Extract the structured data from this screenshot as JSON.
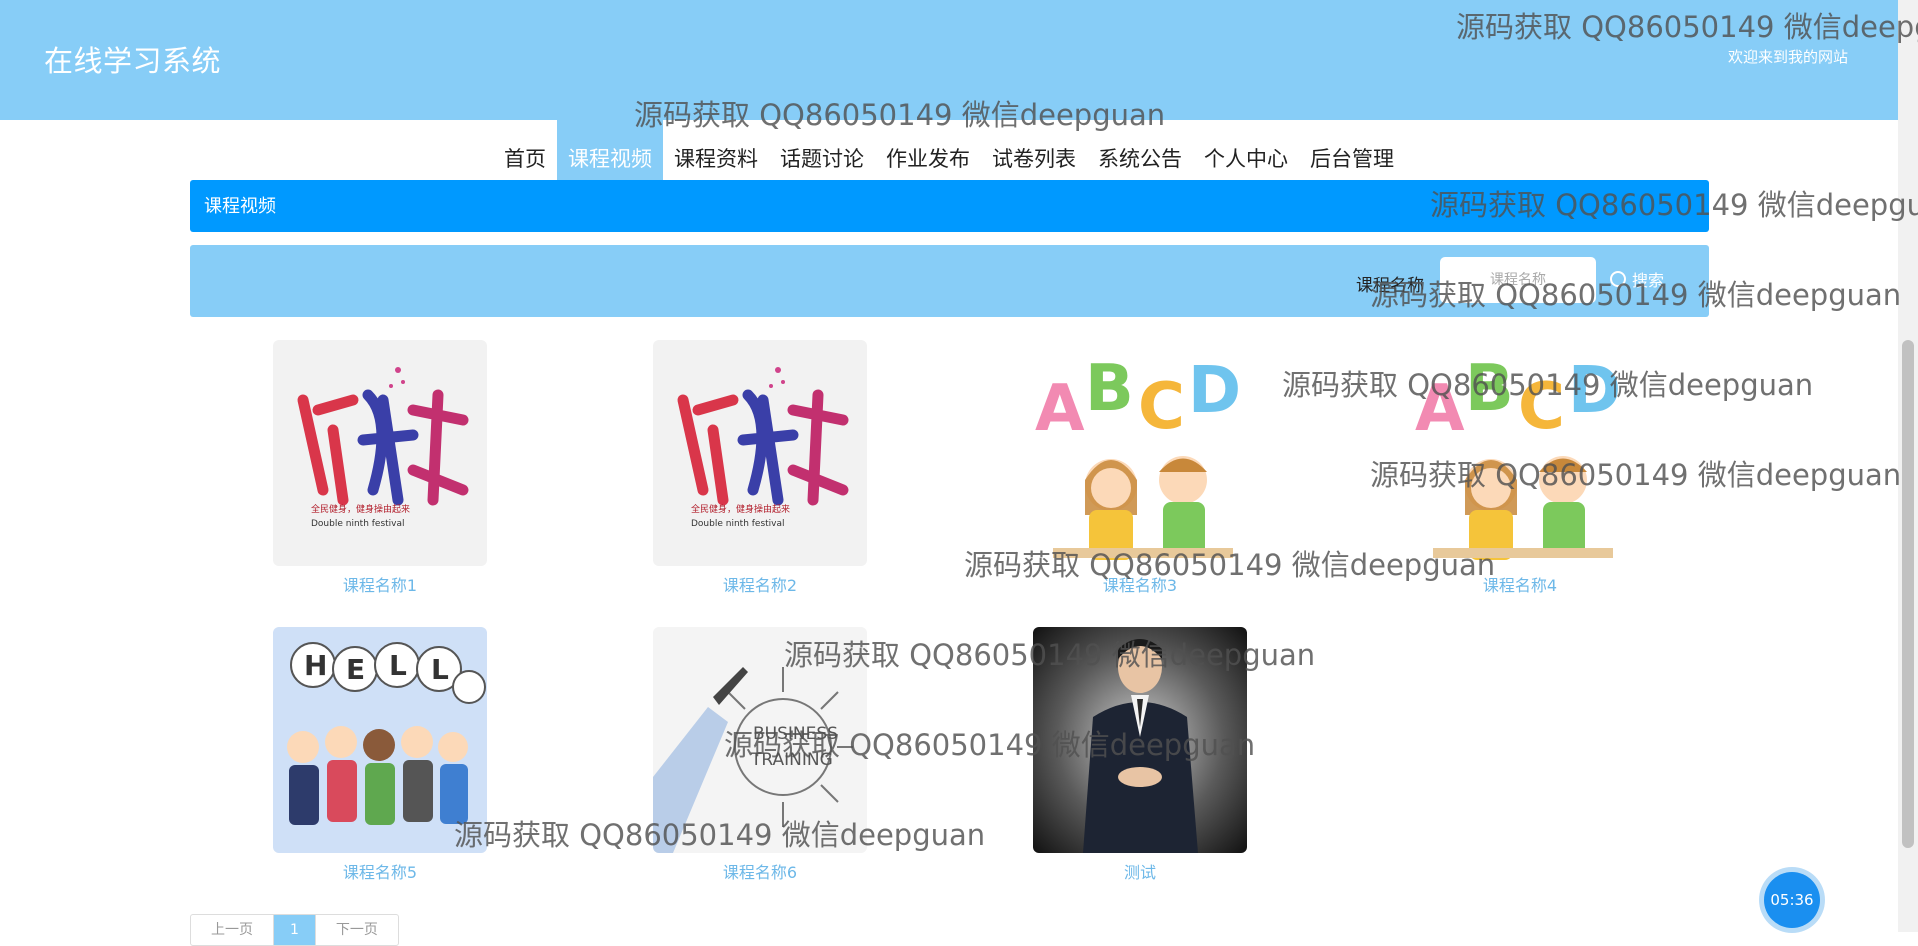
{
  "header": {
    "site_title": "在线学习系统",
    "welcome": "欢迎来到我的网站"
  },
  "nav": {
    "items": [
      "首页",
      "课程视频",
      "课程资料",
      "话题讨论",
      "作业发布",
      "试卷列表",
      "系统公告",
      "个人中心",
      "后台管理"
    ],
    "active": "课程视频"
  },
  "section": {
    "title": "课程视频"
  },
  "search": {
    "label": "课程名称",
    "placeholder": "课程名称",
    "button": "搜索"
  },
  "courses": [
    {
      "title": "课程名称1",
      "image": "fitness-calligraphy-poster"
    },
    {
      "title": "课程名称2",
      "image": "fitness-calligraphy-poster"
    },
    {
      "title": "课程名称3",
      "image": "abcd-kids-cartoon"
    },
    {
      "title": "课程名称4",
      "image": "abcd-kids-cartoon"
    },
    {
      "title": "课程名称5",
      "image": "hello-people-cartoon"
    },
    {
      "title": "课程名称6",
      "image": "business-training-sketch"
    },
    {
      "title": "测试",
      "image": "man-in-suit-photo"
    }
  ],
  "pager": {
    "prev": "上一页",
    "current": "1",
    "next": "下一页"
  },
  "timer": "05:36",
  "watermark": "源码获取 QQ86050149 微信deepguan",
  "colors": {
    "header_bg": "#87cdf7",
    "section_bar": "#0099ff",
    "course_title": "#6db8e8",
    "timer_bg": "#1a8ff0"
  }
}
